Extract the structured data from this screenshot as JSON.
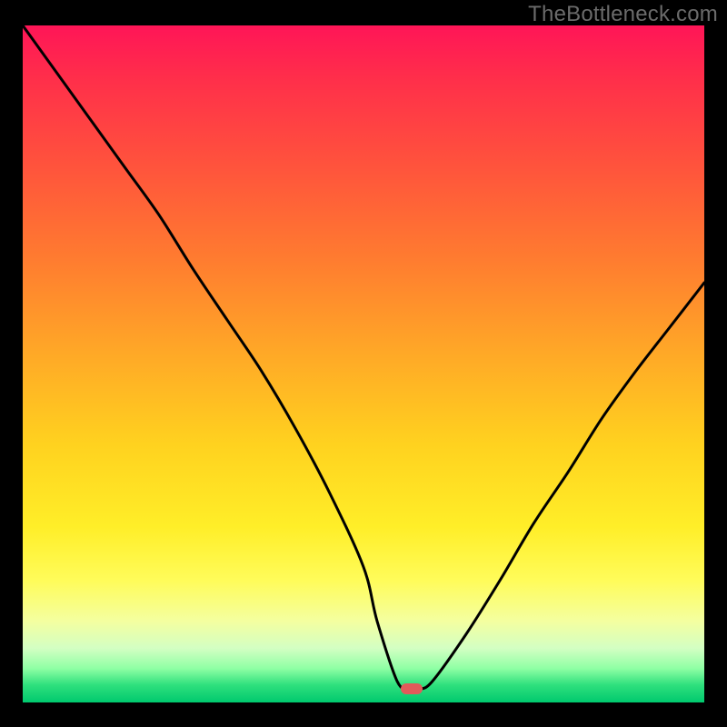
{
  "watermark": "TheBottleneck.com",
  "colors": {
    "frame": "#000000",
    "curve": "#000000",
    "marker": "#e25a5a",
    "gradient_stops": [
      "#ff1557",
      "#ff513d",
      "#ffa727",
      "#ffee28",
      "#f4ffa0",
      "#2fe07d",
      "#00c96e"
    ]
  },
  "chart_data": {
    "type": "line",
    "title": "",
    "xlabel": "",
    "ylabel": "",
    "xlim": [
      0,
      100
    ],
    "ylim": [
      0,
      100
    ],
    "series": [
      {
        "name": "bottleneck-curve",
        "x": [
          0,
          5,
          10,
          15,
          20,
          25,
          30,
          35,
          40,
          45,
          50,
          52,
          55,
          57,
          58,
          60,
          65,
          70,
          75,
          80,
          85,
          90,
          95,
          100
        ],
        "values": [
          100,
          93,
          86,
          79,
          72,
          64,
          56.5,
          49,
          40.5,
          31,
          20,
          12,
          3,
          2,
          2,
          3,
          10,
          18,
          26.5,
          34,
          42,
          49,
          55.5,
          62
        ]
      }
    ],
    "marker": {
      "x": 57,
      "y": 2,
      "shape": "rounded-pill"
    }
  }
}
